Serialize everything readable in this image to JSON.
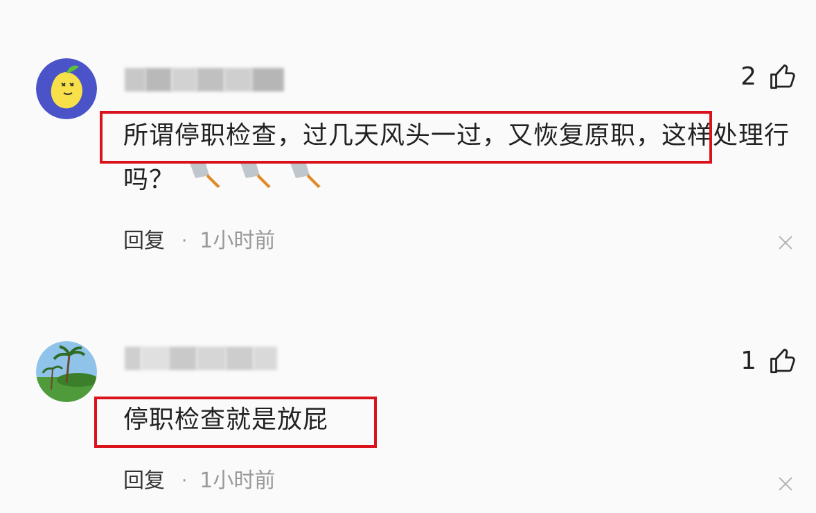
{
  "comments": [
    {
      "likes": "2",
      "text": "所谓停职检查，过几天风头一过，又恢复原职，这样处理行吗？",
      "emoji_icons": [
        "kitchen-knife-icon",
        "kitchen-knife-icon",
        "kitchen-knife-icon"
      ],
      "reply_label": "回复",
      "separator": "·",
      "time": "1小时前",
      "avatar_icon": "lemon-avatar-icon"
    },
    {
      "likes": "1",
      "text": "停职检查就是放屁",
      "reply_label": "回复",
      "separator": "·",
      "time": "1小时前",
      "avatar_icon": "palm-tree-landscape-avatar"
    }
  ],
  "colors": {
    "background": "#fafafa",
    "highlight_border": "#d9121c",
    "text": "#222222",
    "muted": "#999999"
  }
}
